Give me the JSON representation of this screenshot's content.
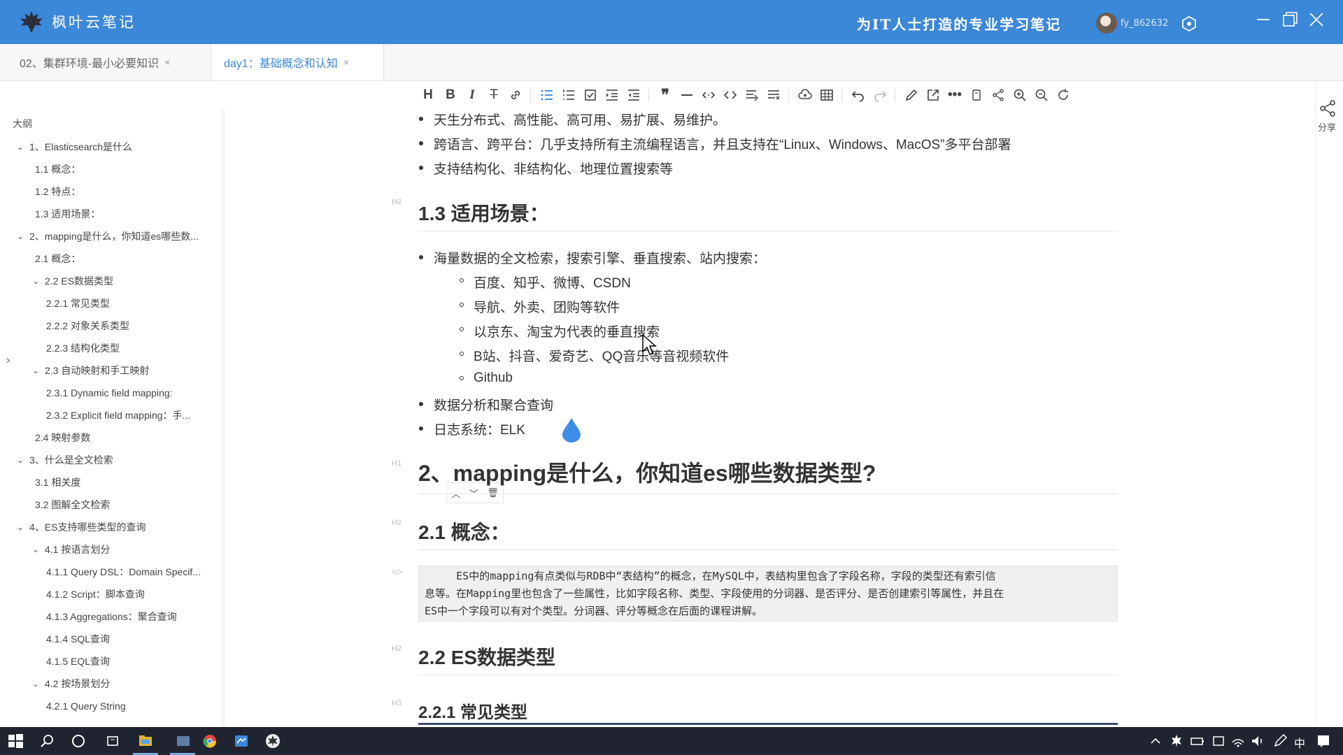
{
  "app": {
    "name": "枫叶云笔记",
    "slogan": "为IT人士打造的专业学习笔记",
    "username": "fy_862632"
  },
  "tabs": [
    {
      "label": "02、集群环境-最小必要知识",
      "close": "×"
    },
    {
      "label": "day1：基础概念和认知",
      "close": "×"
    }
  ],
  "sidebar": {
    "title": "大纲",
    "items": [
      {
        "label": "1、Elasticsearch是什么",
        "level": 0,
        "expanded": true
      },
      {
        "label": "1.1 概念：",
        "level": 1
      },
      {
        "label": "1.2 特点：",
        "level": 1
      },
      {
        "label": "1.3 适用场景：",
        "level": 1
      },
      {
        "label": "2、mapping是什么，你知道es哪些数...",
        "level": 0,
        "expanded": true
      },
      {
        "label": "2.1 概念：",
        "level": 1
      },
      {
        "label": "2.2 ES数据类型",
        "level": 1,
        "expanded": true
      },
      {
        "label": "2.2.1 常见类型",
        "level": 2
      },
      {
        "label": "2.2.2 对象关系类型",
        "level": 2
      },
      {
        "label": "2.2.3 结构化类型",
        "level": 2
      },
      {
        "label": "2.3 自动映射和手工映射",
        "level": 1,
        "expanded": true
      },
      {
        "label": "2.3.1 Dynamic field mapping:",
        "level": 2
      },
      {
        "label": "2.3.2 Explicit field mapping：手...",
        "level": 2
      },
      {
        "label": "2.4 映射参数",
        "level": 1
      },
      {
        "label": "3、什么是全文检索",
        "level": 0,
        "expanded": true
      },
      {
        "label": "3.1 相关度",
        "level": 1
      },
      {
        "label": "3.2 图解全文检索",
        "level": 1
      },
      {
        "label": "4、ES支持哪些类型的查询",
        "level": 0,
        "expanded": true
      },
      {
        "label": "4.1 按语言划分",
        "level": 1,
        "expanded": true
      },
      {
        "label": "4.1.1 Query DSL：Domain Specif...",
        "level": 2
      },
      {
        "label": "4.1.2 Script：脚本查询",
        "level": 2
      },
      {
        "label": "4.1.3 Aggregations：聚合查询",
        "level": 2
      },
      {
        "label": "4.1.4 SQL查询",
        "level": 2
      },
      {
        "label": "4.1.5 EQL查询",
        "level": 2
      },
      {
        "label": "4.2 按场景划分",
        "level": 1,
        "expanded": true
      },
      {
        "label": "4.2.1 Query String",
        "level": 2
      }
    ]
  },
  "share_label": "分享",
  "editor": {
    "intro_bullets": [
      "天生分布式、高性能、高可用、易扩展、易维护。",
      "跨语言、跨平台：几乎支持所有主流编程语言，并且支持在“Linux、Windows、MacOS”多平台部署",
      "支持结构化、非结构化、地理位置搜索等"
    ],
    "h_1_3": "1.3 适用场景：",
    "scene_main": "海量数据的全文检索，搜索引擎、垂直搜索、站内搜索：",
    "scene_sub": [
      "百度、知乎、微博、CSDN",
      "导航、外卖、团购等软件",
      "以京东、淘宝为代表的垂直搜索",
      "B站、抖音、爱奇艺、QQ音乐等音视频软件",
      "Github"
    ],
    "scene_more": [
      "数据分析和聚合查询",
      "日志系统：ELK"
    ],
    "h_2": "2、mapping是什么，你知道es哪些数据类型?",
    "h_2_1": "2.1 概念：",
    "code_lines": [
      "     ES中的mapping有点类似与RDB中“表结构”的概念，在MySQL中，表结构里包含了字段名称，字段的类型还有索引信",
      "息等。在Mapping里也包含了一些属性，比如字段名称、类型、字段使用的分词器、是否评分、是否创建索引等属性，并且在",
      "ES中一个字段可以有对个类型。分词器、评分等概念在后面的课程讲解。"
    ],
    "h_2_2": "2.2 ES数据类型",
    "h_2_2_1": "2.2.1 常见类型",
    "marks": {
      "h1": "H1",
      "h2": "H2",
      "h3": "H3",
      "code": "</>"
    }
  },
  "taskbar": {
    "ime": "中"
  }
}
